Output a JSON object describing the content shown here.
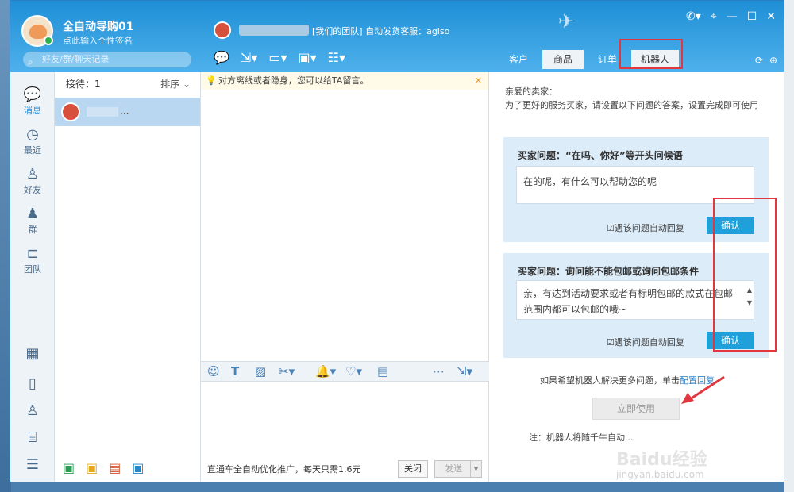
{
  "profile": {
    "nickname": "全自动导购01",
    "signature": "点此输入个性签名"
  },
  "search": {
    "placeholder": "好友/群/聊天记录"
  },
  "chat_header": {
    "title": "[我们的团队] 自动发货客服：agiso"
  },
  "top_tabs": [
    {
      "label": "客户"
    },
    {
      "label": "商品"
    },
    {
      "label": "订单"
    },
    {
      "label": "机器人"
    }
  ],
  "sidebar": {
    "items": [
      {
        "label": "消息",
        "icon": "chat-bubble-icon"
      },
      {
        "label": "最近",
        "icon": "clock-icon"
      },
      {
        "label": "好友",
        "icon": "person-icon"
      },
      {
        "label": "群",
        "icon": "group-icon"
      },
      {
        "label": "团队",
        "icon": "team-icon"
      }
    ]
  },
  "list": {
    "waiting_label": "接待：1",
    "sort_label": "排序",
    "item_suffix": "..."
  },
  "chat": {
    "notice": "对方离线或者隐身，您可以给TA留言。",
    "ad": "直通车全自动优化推广，每天只需1.6元",
    "close_label": "关闭",
    "send_label": "发送"
  },
  "robot": {
    "intro_greeting": "亲爱的卖家：",
    "intro_text": "为了更好的服务买家，请设置以下问题的答案，设置完成即可使用",
    "questions": [
      {
        "title": "买家问题：“在吗、你好”等开头问候语",
        "answer": "在的呢，有什么可以帮助您的呢",
        "auto_reply_label": "遇该问题自动回复",
        "confirm_label": "确认"
      },
      {
        "title": "买家问题：询问能不能包邮或询问包邮条件",
        "answer": "亲，有达到活动要求或者有标明包邮的款式在包邮范围内都可以包邮的哦~",
        "auto_reply_label": "遇该问题自动回复",
        "confirm_label": "确认"
      }
    ],
    "more_text": "如果希望机器人解决更多问题，单击",
    "more_link": "配置回复",
    "use_now_label": "立即使用",
    "note": "注：机器人将随千牛自动..."
  },
  "watermark": {
    "logo": "Baidu经验",
    "url": "jingyan.baidu.com"
  },
  "colors": {
    "title_bar": "#1e8fd6",
    "accent": "#1fa0db",
    "highlight": "#e0383e"
  }
}
